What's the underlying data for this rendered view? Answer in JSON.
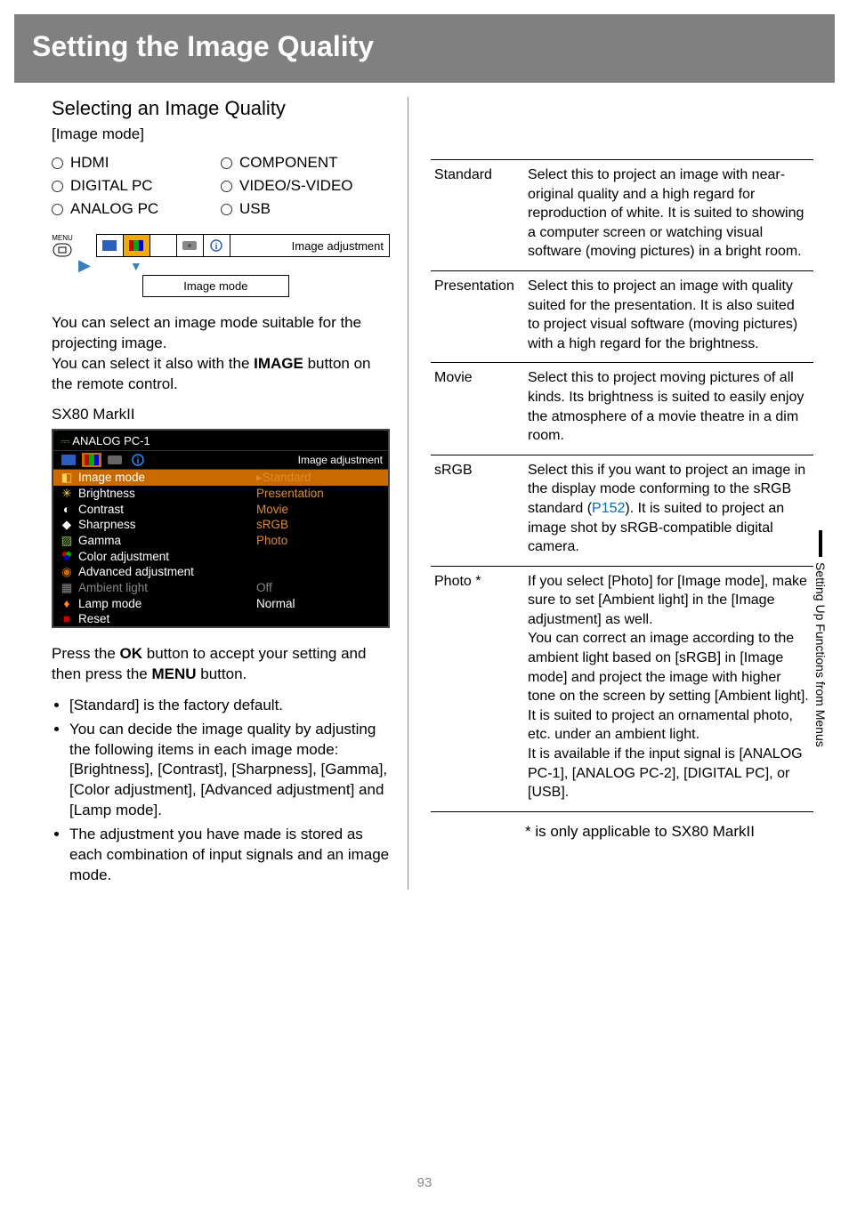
{
  "header": {
    "title": "Setting the Image Quality"
  },
  "left": {
    "section_heading": "Selecting an Image Quality",
    "sub_label": "[Image mode]",
    "inputs": [
      "HDMI",
      "COMPONENT",
      "DIGITAL PC",
      "VIDEO/S-VIDEO",
      "ANALOG PC",
      "USB"
    ],
    "nav": {
      "menu_label": "MENU",
      "image_adjustment": "Image adjustment",
      "image_mode_box": "Image mode"
    },
    "para1_a": "You can select an image mode suitable for the projecting image.",
    "para1_b_pre": "You can select it also with the ",
    "para1_b_bold": "IMAGE",
    "para1_b_post": " button on the remote control.",
    "device_label": "SX80 MarkII",
    "osd": {
      "title": "ANALOG PC-1",
      "adjust_label": "Image adjustment",
      "active_row": "Image mode",
      "active_value": "Standard",
      "options": [
        "Presentation",
        "Movie",
        "sRGB",
        "Photo"
      ],
      "rows": [
        {
          "label": "Brightness",
          "value": ""
        },
        {
          "label": "Contrast",
          "value": ""
        },
        {
          "label": "Sharpness",
          "value": ""
        },
        {
          "label": "Gamma",
          "value": ""
        },
        {
          "label": "Color adjustment",
          "value": ""
        },
        {
          "label": "Advanced adjustment",
          "value": ""
        }
      ],
      "ambient_row": {
        "label": "Ambient light",
        "value": "Off"
      },
      "lamp_row": {
        "label": "Lamp mode",
        "value": "Normal"
      },
      "reset_row": {
        "label": "Reset"
      }
    },
    "para2_pre": "Press the ",
    "para2_ok": "OK",
    "para2_mid": " button to accept your setting and then press the ",
    "para2_menu": "MENU",
    "para2_post": " button.",
    "bullets": [
      "[Standard] is the factory default.",
      "You can decide the image quality by adjusting the following items in each image mode:\n[Brightness], [Contrast], [Sharpness], [Gamma], [Color adjustment], [Advanced adjustment] and [Lamp mode].",
      "The adjustment you have made is stored as each combination of input signals and an image mode."
    ]
  },
  "right": {
    "modes": [
      {
        "name": "Standard",
        "desc": "Select this to project an image with near-original quality and a high regard for reproduction of white. It is suited to showing a computer screen or watching visual software (moving pictures) in a bright room."
      },
      {
        "name": "Presentation",
        "desc": "Select this to project an image with quality suited for the presentation. It is also suited to project visual software (moving pictures) with a high regard for the brightness."
      },
      {
        "name": "Movie",
        "desc": "Select this to project moving pictures of all kinds. Its brightness is suited to easily enjoy the atmosphere of a movie theatre in a dim room."
      },
      {
        "name": "sRGB",
        "desc_pre": "Select this if you want to project an image in the display mode conforming to the sRGB standard (",
        "link": "P152",
        "desc_post": "). It is suited to project an image shot by sRGB-compatible digital camera."
      },
      {
        "name": "Photo *",
        "desc": "If you select [Photo] for [Image mode], make sure to set [Ambient light] in the [Image adjustment] as well.\nYou can correct an image according to the ambient light based on [sRGB] in [Image mode] and project the image with higher tone on the screen by setting [Ambient light]. It is suited to project an ornamental photo, etc. under an ambient light.\nIt is available if the input signal is [ANALOG PC-1], [ANALOG PC-2], [DIGITAL PC], or [USB]."
      }
    ],
    "footnote": "* is only applicable to SX80 MarkII"
  },
  "side_tab": "Setting Up Functions from Menus",
  "page_number": "93"
}
